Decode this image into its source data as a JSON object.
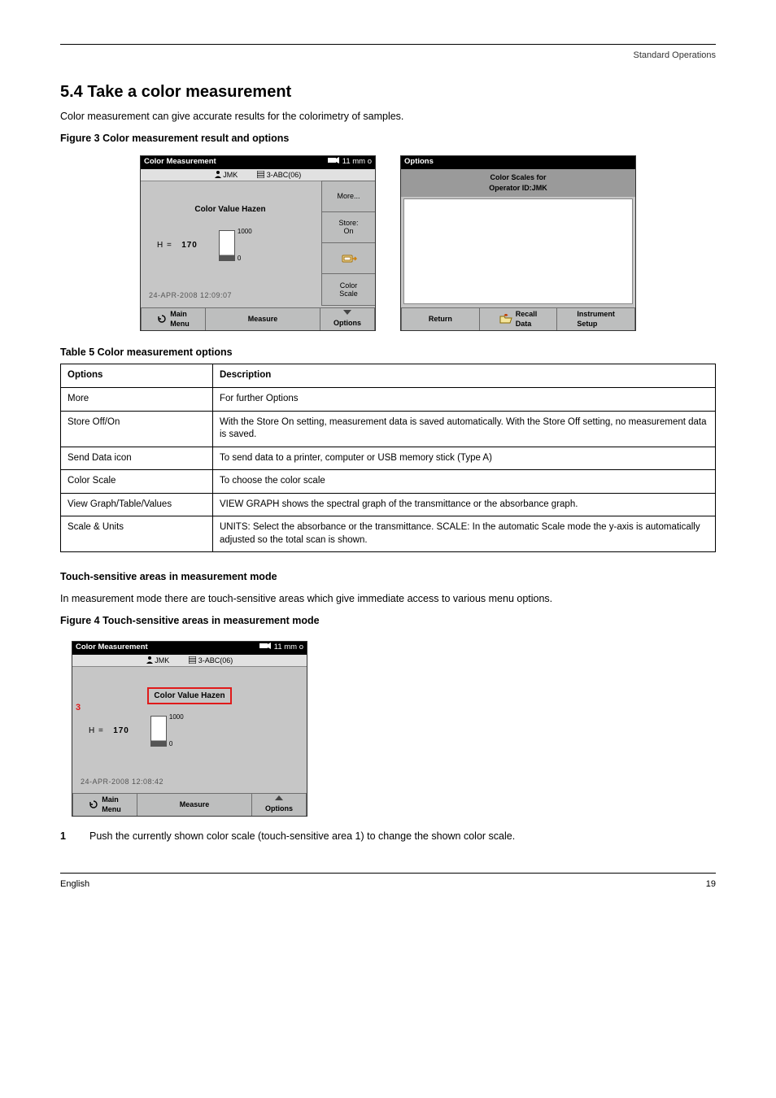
{
  "runhead": "Standard Operations",
  "h1": "5.4 Take a color measurement",
  "intro": "Color measurement can give accurate results for the colorimetry of samples.",
  "figcap1": "Figure 3 Color measurement result and options",
  "panel_cm": {
    "title": "Color Measurement",
    "status": "11 mm o",
    "op": "JMK",
    "sample": "3-ABC(06)",
    "cvh": "Color Value Hazen",
    "h_label": "H =",
    "h_value": "170",
    "bar_hi": "1000",
    "bar_lo": "0",
    "ts": "24-APR-2008  12:09:07",
    "btn_more": "More...",
    "btn_store": "Store:\nOn",
    "btn_pc": "",
    "btn_scale": "Color\nScale",
    "btn_main": "Main\nMenu",
    "btn_meas": "Measure",
    "btn_opts": "Options"
  },
  "panel_opt": {
    "title": "Options",
    "sub_l1": "Color Scales for",
    "sub_l2": "Operator ID:JMK",
    "btn_return": "Return",
    "btn_recall": "Recall\nData",
    "btn_instr": "Instrument\nSetup"
  },
  "table_caption": "Table 5 Color measurement options",
  "table": {
    "h1": "Options",
    "h2": "Description",
    "rows": [
      [
        "More",
        "For further Options"
      ],
      [
        "Store Off/On",
        "With the Store On setting, measurement data is saved automatically. With the Store Off setting, no measurement data is saved."
      ],
      [
        "Send Data icon",
        "To send data to a printer, computer or USB memory stick (Type A)"
      ],
      [
        "Color Scale",
        "To choose the color scale"
      ],
      [
        "View Graph/Table/Values",
        "VIEW GRAPH shows the spectral graph of the transmittance or the absorbance graph."
      ],
      [
        "Scale & Units",
        "UNITS: Select the absorbance or the transmittance. SCALE: In the automatic Scale mode the y-axis is automatically adjusted so the total scan is shown."
      ]
    ]
  },
  "touch_areas_h": "Touch-sensitive areas in measurement mode",
  "touch_areas_p": "In measurement mode there are touch-sensitive areas which give immediate access to various menu options.",
  "figcap2": "Figure 4 Touch-sensitive areas in measurement mode",
  "panel_cm2": {
    "title": "Color Measurement",
    "status": "11 mm o",
    "op": "JMK",
    "sample": "3-ABC(06)",
    "cvh": "Color Value Hazen",
    "h_label": "H =",
    "h_value": "170",
    "bar_hi": "1000",
    "bar_lo": "0",
    "ts": "24-APR-2008  12:08:42",
    "btn_main": "Main\nMenu",
    "btn_meas": "Measure",
    "btn_opts": "Options",
    "red3": "3"
  },
  "step": {
    "n": "1",
    "text": "Push the currently shown color scale (touch-sensitive area 1) to change the shown color scale."
  },
  "footer": {
    "left": "English",
    "right": "19"
  }
}
